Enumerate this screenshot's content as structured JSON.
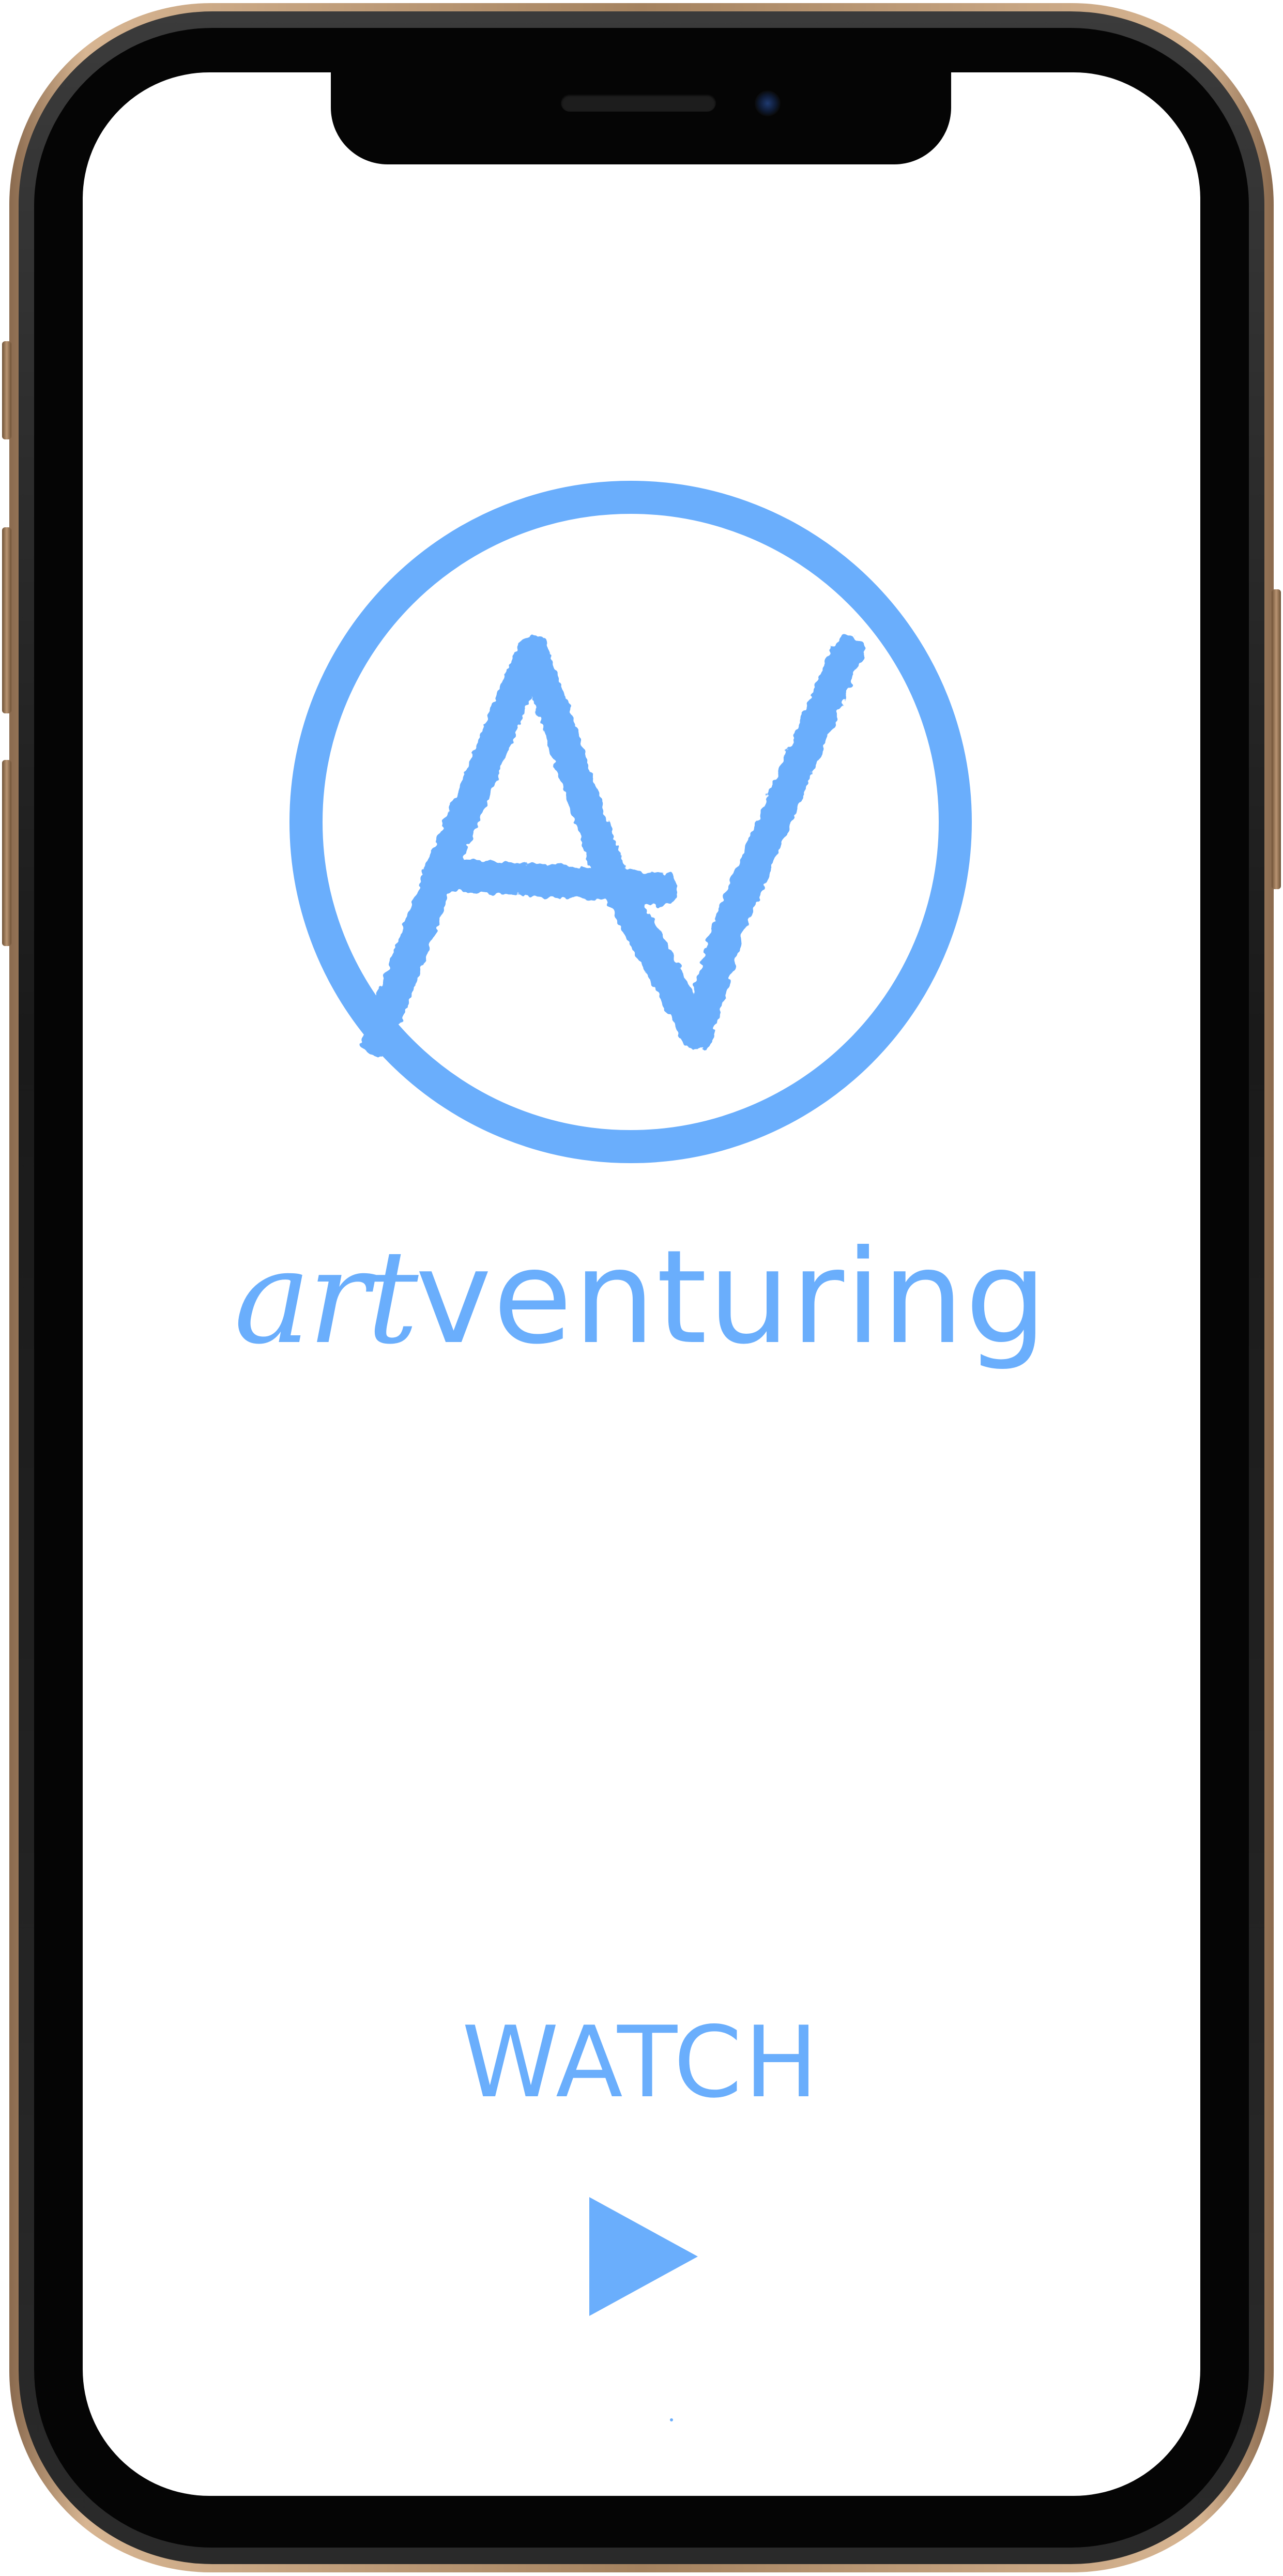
{
  "app": {
    "name": "artventuring",
    "logo_monogram": "AV",
    "wordmark_script": "art",
    "wordmark_sans": "venturing"
  },
  "main": {
    "watch_label": "WATCH",
    "play_icon": "play-icon"
  },
  "colors": {
    "accent": "#6aaefc",
    "screen_background": "#ffffff",
    "bezel": "#050505",
    "frame_gold": "#d7b592"
  },
  "icons": {
    "logo": "av-monogram-logo",
    "play": "play-icon"
  }
}
